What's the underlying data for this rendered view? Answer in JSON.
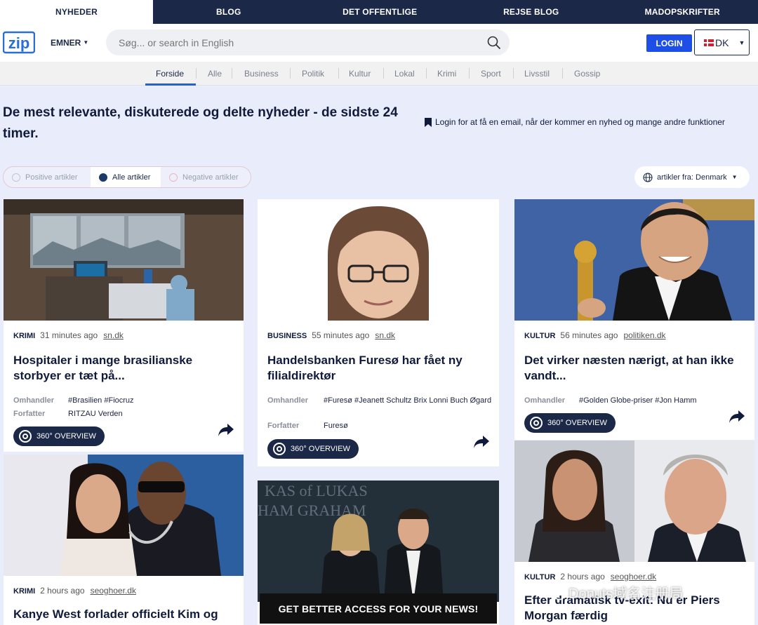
{
  "topnav": {
    "tabs": [
      {
        "label": "NYHEDER",
        "active": true
      },
      {
        "label": "BLOG"
      },
      {
        "label": "DET OFFENTLIGE"
      },
      {
        "label": "REJSE BLOG"
      },
      {
        "label": "MADOPSKRIFTER"
      }
    ]
  },
  "header": {
    "logo": "zip",
    "emner": "EMNER",
    "search_placeholder": "Søg... or search in English",
    "login": "LOGIN",
    "lang": "DK"
  },
  "categories": [
    "Forside",
    "Alle",
    "Business",
    "Politik",
    "Kultur",
    "Lokal",
    "Krimi",
    "Sport",
    "Livsstil",
    "Gossip"
  ],
  "headline": "De mest relevante, diskuterede og delte nyheder - de sidste 24 timer.",
  "login_note": "Login for at få en email, når der kommer en nyhed og mange andre funktioner",
  "filters": {
    "positive": "Positive artikler",
    "all": "Alle artikler",
    "negative": "Negative artikler"
  },
  "country": "artikler fra: Denmark",
  "labels": {
    "omhandler": "Omhandler",
    "forfatter": "Forfatter",
    "overview": "360° OVERVIEW"
  },
  "cards": [
    {
      "category": "KRIMI",
      "time": "31 minutes ago",
      "source": "sn.dk",
      "title": "Hospitaler i mange brasilianske storbyer er tæt på...",
      "tags": "#Brasilien #Fiocruz",
      "author": "RITZAU  Verden"
    },
    {
      "category": "BUSINESS",
      "time": "55 minutes ago",
      "source": "sn.dk",
      "title": "Handelsbanken Furesø har fået ny filialdirektør",
      "tags": "#Furesø #Jeanett Schultz Brix Lonni Buch Øgard",
      "author": "Furesø"
    },
    {
      "category": "KULTUR",
      "time": "56 minutes ago",
      "source": "politiken.dk",
      "title": "Det virker næsten nærigt, at han ikke vandt...",
      "tags": "#Golden Globe-priser #Jon Hamm"
    },
    {
      "category": "KRIMI",
      "time": "2 hours ago",
      "source": "seoghoer.dk",
      "title": "Kanye West forlader officielt Kim og"
    },
    {
      "category": "KULTUR",
      "time": "2 hours ago",
      "source": "seoghoer.dk",
      "title": "Efter dramatisk tv-exit: Nu er Piers Morgan færdig"
    }
  ],
  "cta": "GET BETTER ACCESS FOR YOUR NEWS!",
  "watermark": "Donuts域名注册局",
  "colors": {
    "navy": "#1b2847",
    "login_blue": "#1d4ee6",
    "page_bg": "#e8ecfb"
  }
}
